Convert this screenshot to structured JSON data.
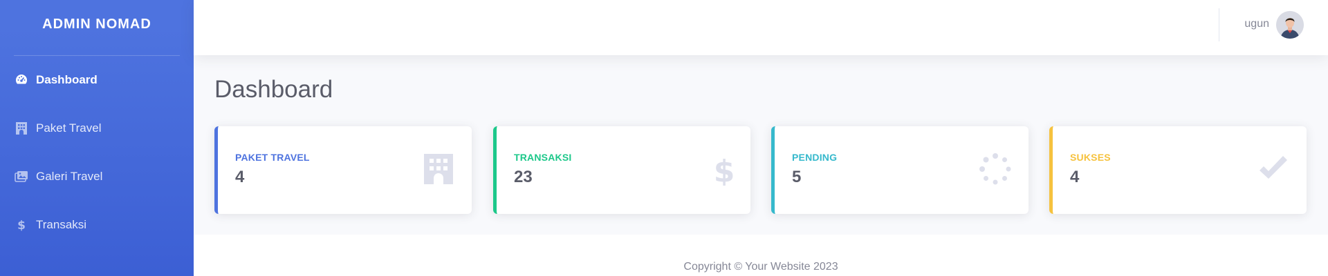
{
  "sidebar": {
    "brand": "ADMIN NOMAD",
    "items": [
      {
        "label": "Dashboard",
        "icon": "tachometer-icon",
        "active": true
      },
      {
        "label": "Paket Travel",
        "icon": "hotel-icon",
        "active": false
      },
      {
        "label": "Galeri Travel",
        "icon": "images-icon",
        "active": false
      },
      {
        "label": "Transaksi",
        "icon": "dollar-icon",
        "active": false
      }
    ]
  },
  "topbar": {
    "user_name": "ugun",
    "avatar_icon": "user-avatar"
  },
  "main": {
    "page_title": "Dashboard",
    "cards": [
      {
        "label": "PAKET TRAVEL",
        "value": "4",
        "accent": "#4e73df",
        "icon": "building-icon"
      },
      {
        "label": "TRANSAKSI",
        "value": "23",
        "accent": "#1cc88a",
        "icon": "dollar-icon"
      },
      {
        "label": "PENDING",
        "value": "5",
        "accent": "#36b9cc",
        "icon": "spinner-icon"
      },
      {
        "label": "SUKSES",
        "value": "4",
        "accent": "#f6c23e",
        "icon": "check-icon"
      }
    ]
  },
  "footer": {
    "copyright": "Copyright © Your Website 2023"
  },
  "colors": {
    "primary": "#4e73df",
    "success": "#1cc88a",
    "info": "#36b9cc",
    "warning": "#f6c23e",
    "text": "#5a5c69",
    "muted": "#858796",
    "icon_muted": "#dddfeb"
  }
}
